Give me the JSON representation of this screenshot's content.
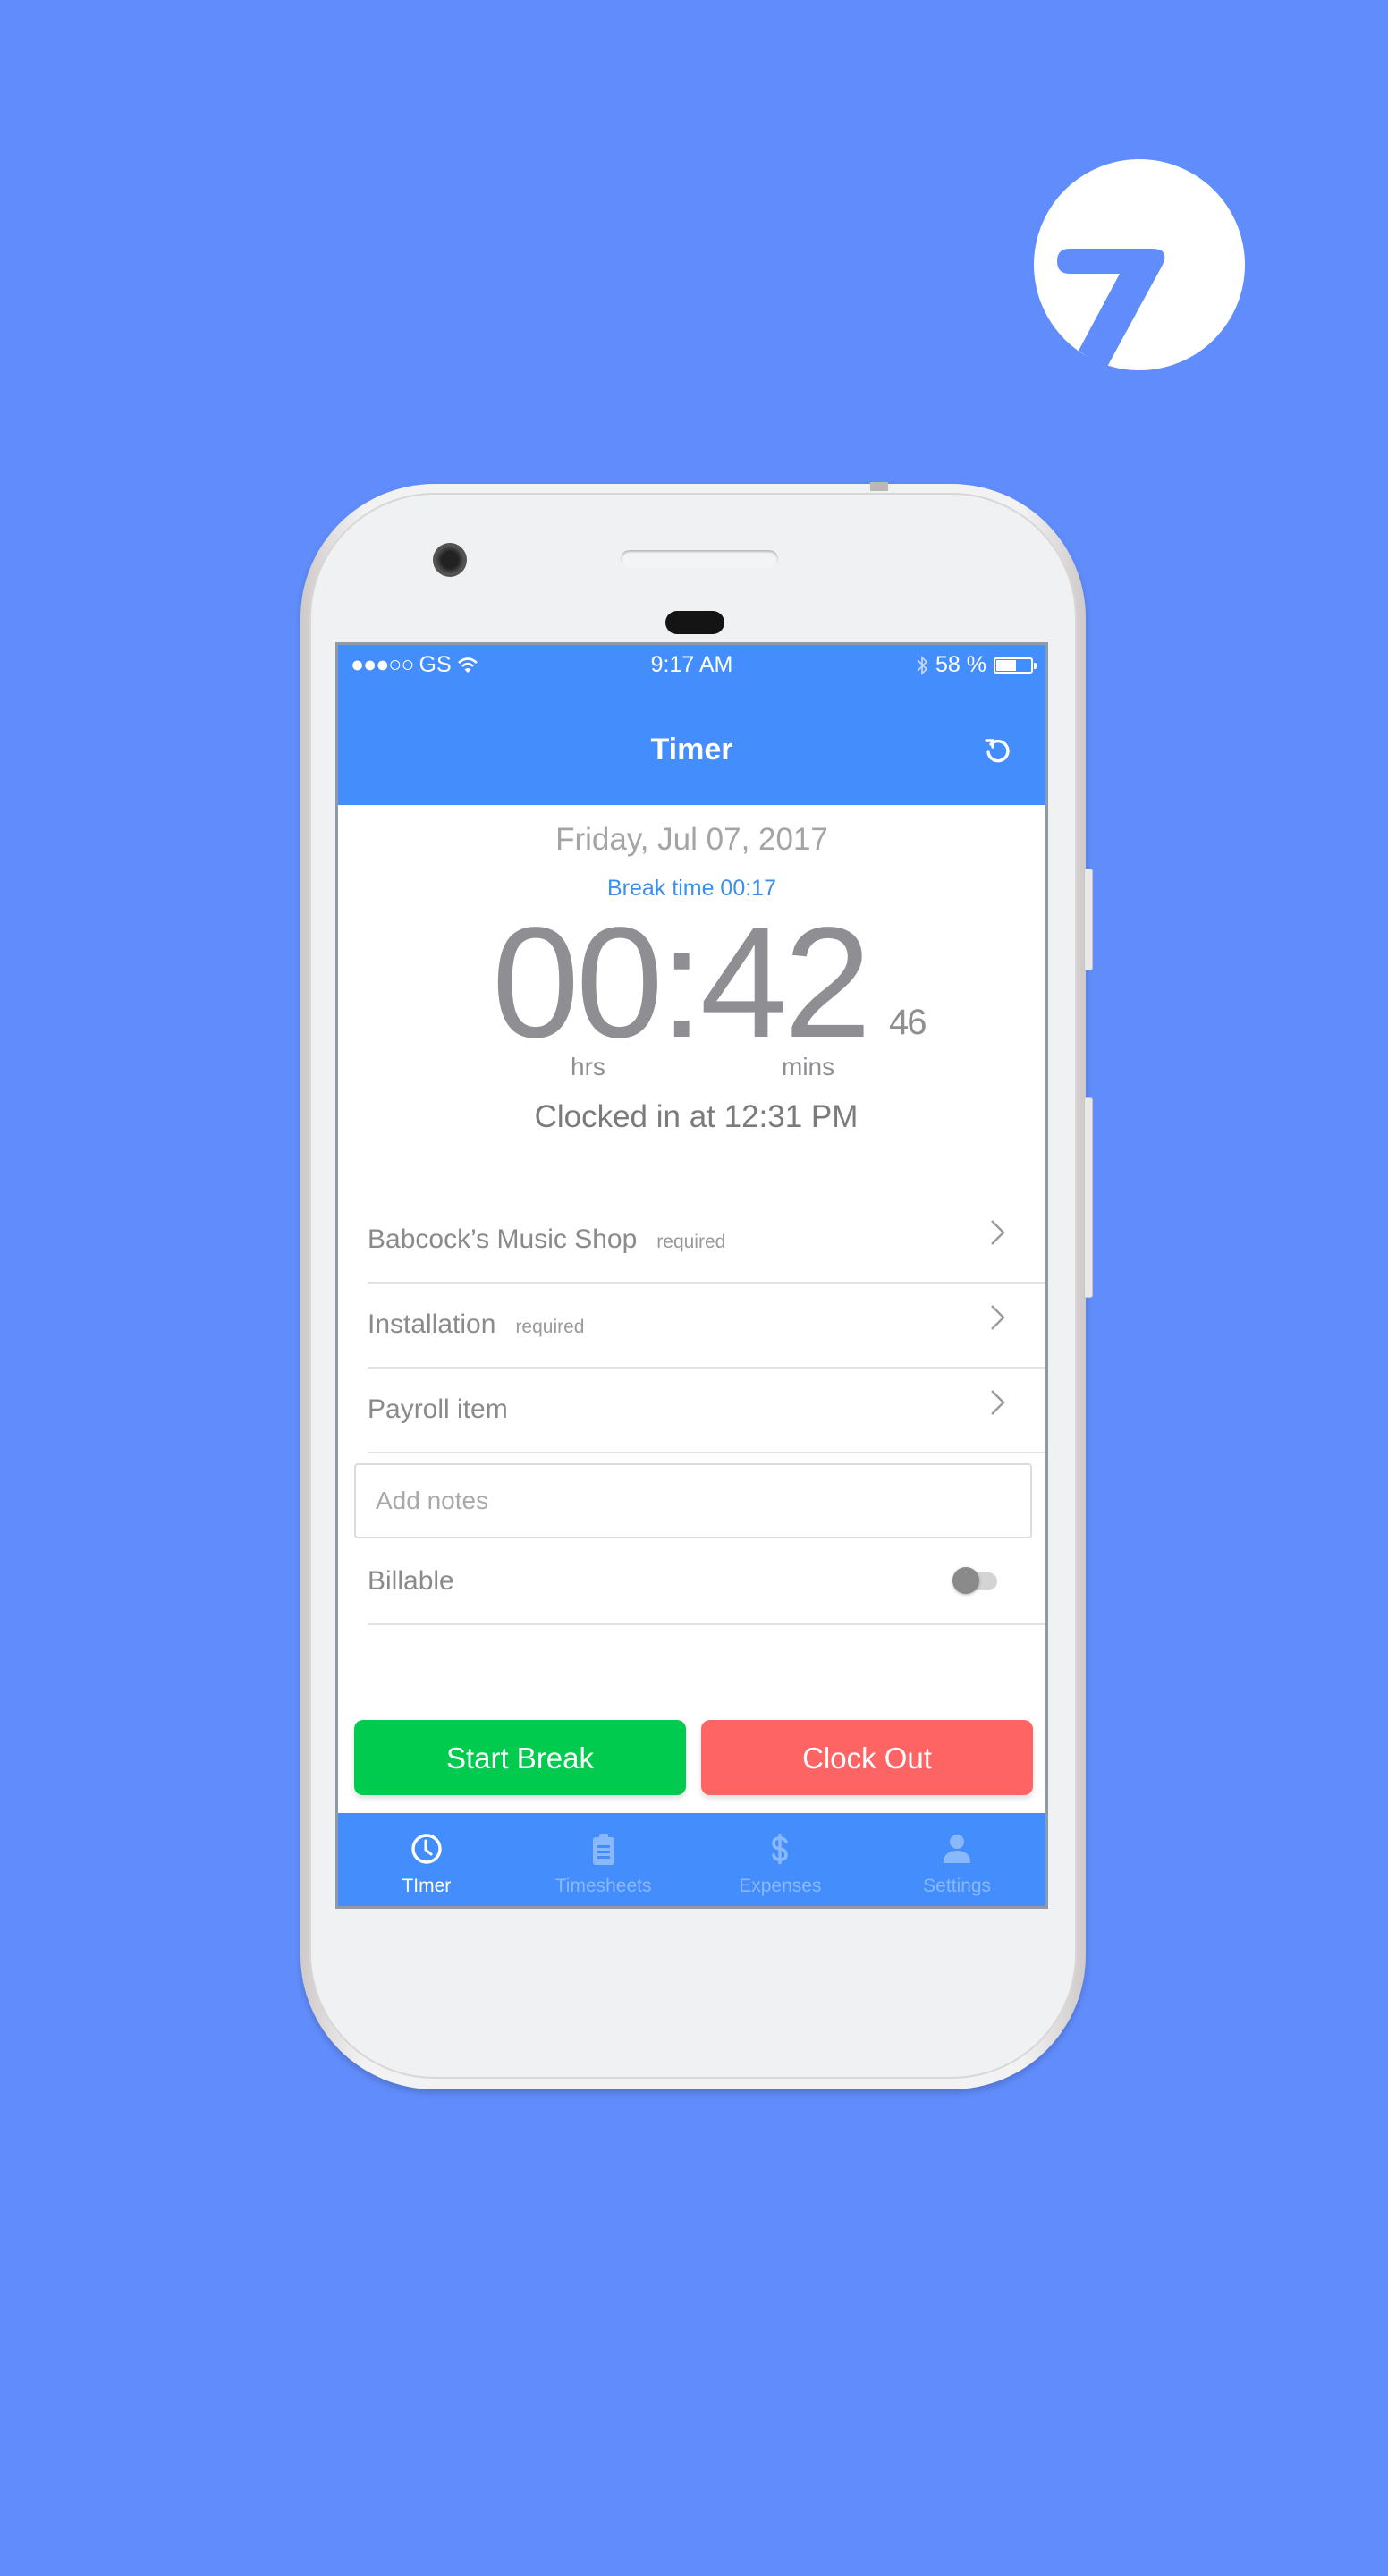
{
  "colors": {
    "background": "#618dfc",
    "brand_blue": "#438dfd",
    "break_text": "#3b8ff0",
    "start_break": "#00cb4e",
    "clock_out": "#fe6464",
    "tab_inactive": "#8ab8fd"
  },
  "logo": {
    "icon": "seven-logo-icon"
  },
  "status_bar": {
    "signal": "●●●○○",
    "carrier": "GS",
    "wifi_icon": "wifi-icon",
    "time": "9:17 AM",
    "bluetooth_icon": "bluetooth-icon",
    "battery_percent_label": "58 %",
    "battery_level": 0.58
  },
  "header": {
    "title": "Timer",
    "refresh_icon": "refresh-icon"
  },
  "timer": {
    "date": "Friday, Jul 07, 2017",
    "break_time": "Break time 00:17",
    "elapsed_hm": "00:42",
    "elapsed_seconds": "46",
    "hours_label": "hrs",
    "minutes_label": "mins",
    "clocked_in": "Clocked in at 12:31 PM"
  },
  "fields": [
    {
      "label": "Babcock’s Music Shop",
      "badge": "required",
      "icon": "chevron-right-icon"
    },
    {
      "label": "Installation",
      "badge": "required",
      "icon": "chevron-right-icon"
    },
    {
      "label": "Payroll item",
      "badge": "",
      "icon": "chevron-right-icon"
    }
  ],
  "notes": {
    "placeholder": "Add notes",
    "value": ""
  },
  "billable": {
    "label": "Billable",
    "on": false
  },
  "actions": {
    "start_break": "Start Break",
    "clock_out": "Clock Out"
  },
  "tabs": [
    {
      "label": "TImer",
      "icon": "clock-icon",
      "active": true
    },
    {
      "label": "Timesheets",
      "icon": "clipboard-icon",
      "active": false
    },
    {
      "label": "Expenses",
      "icon": "dollar-icon",
      "active": false
    },
    {
      "label": "Settings",
      "icon": "person-icon",
      "active": false
    }
  ]
}
